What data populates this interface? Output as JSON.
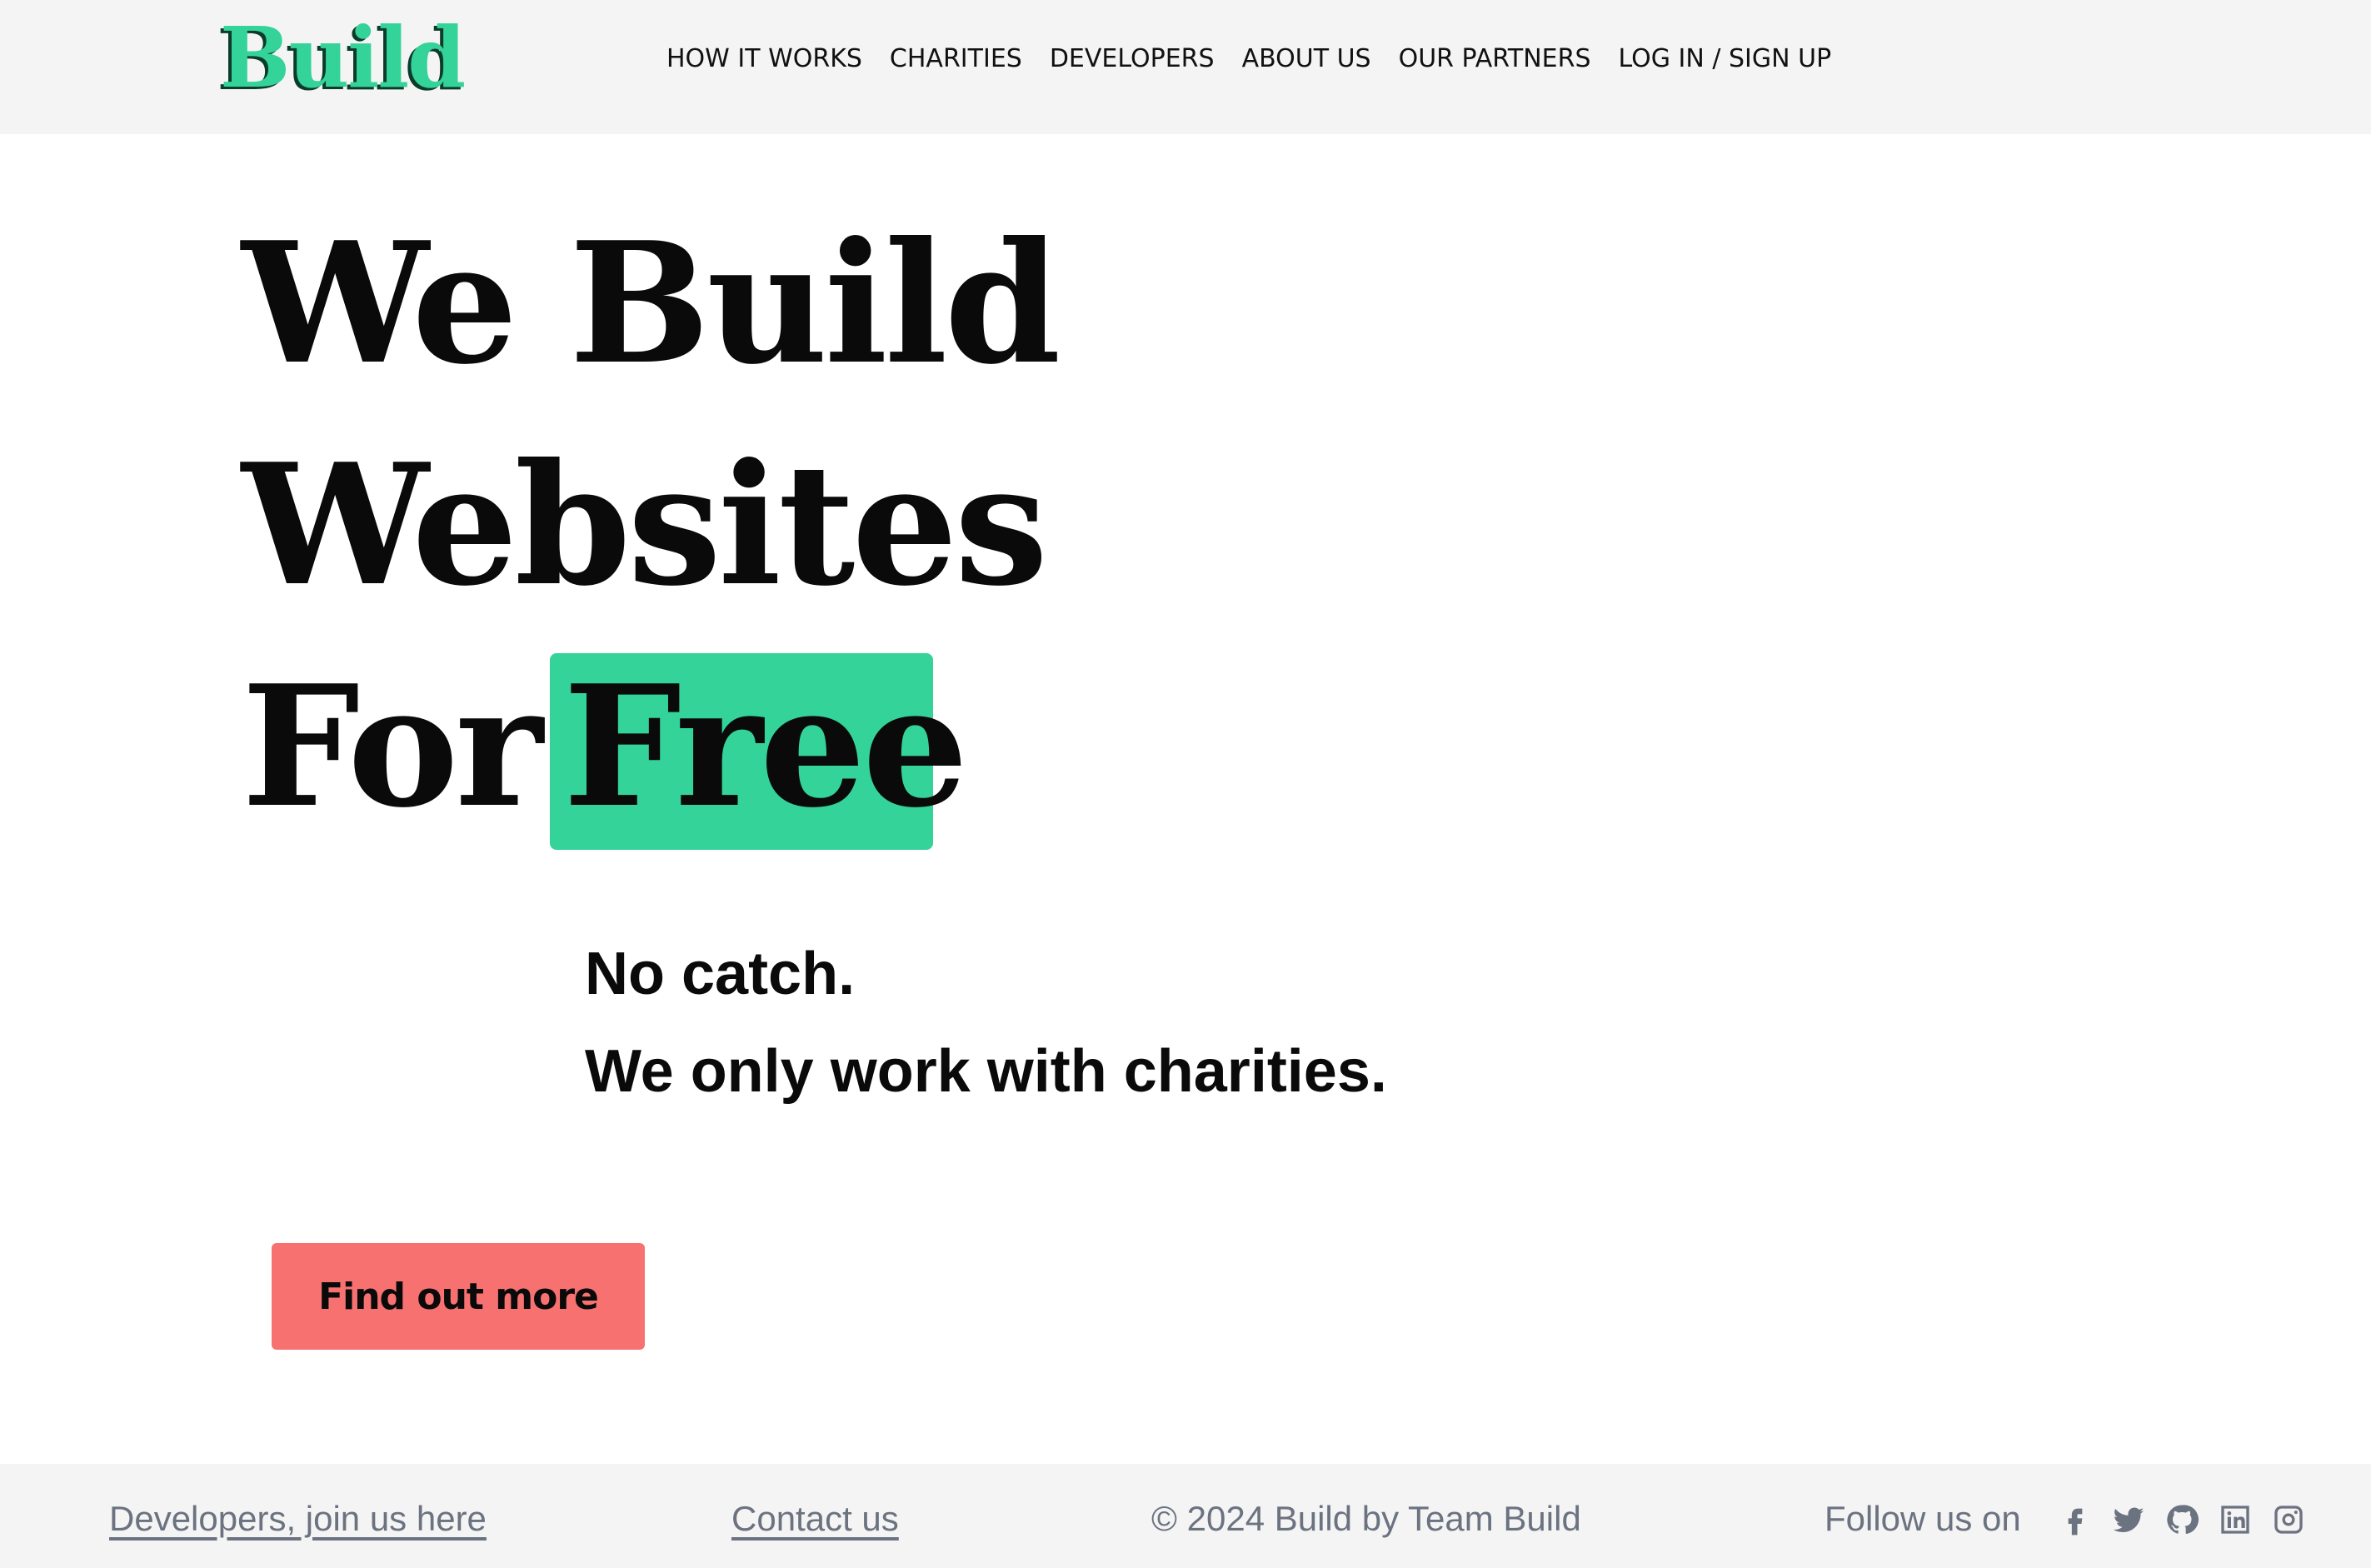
{
  "header": {
    "logo": "Build",
    "nav": [
      "HOW IT WORKS",
      "CHARITIES",
      "DEVELOPERS",
      "ABOUT US",
      "OUR PARTNERS",
      "LOG IN / SIGN UP"
    ]
  },
  "hero": {
    "line1": "We Build",
    "line2": "Websites",
    "line3_prefix": "For",
    "line3_highlight": "Free",
    "subline1": "No catch.",
    "subline2": "We only work with charities.",
    "cta_label": "Find out more"
  },
  "footer": {
    "developers_link": "Developers, join us here",
    "contact_link": "Contact us",
    "copyright": "© 2024 Build by Team Build",
    "follow_label": "Follow us on",
    "social_icons": [
      "facebook-icon",
      "twitter-icon",
      "github-icon",
      "linkedin-icon",
      "instagram-icon"
    ]
  },
  "colors": {
    "accent": "#34d399",
    "cta": "#f87171",
    "header_bg": "#f4f4f4",
    "footer_text": "#6b7280"
  }
}
